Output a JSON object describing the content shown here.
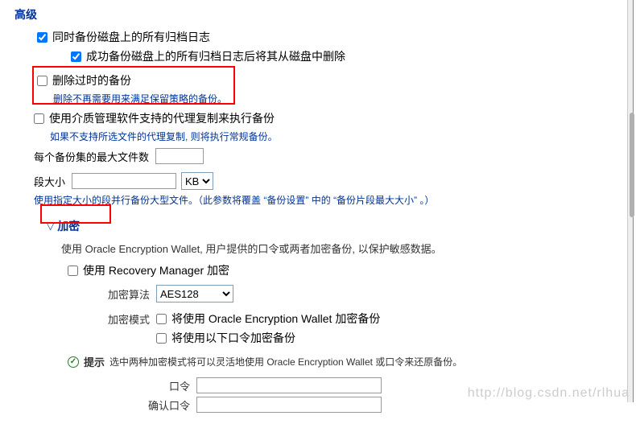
{
  "section": {
    "title": "高级"
  },
  "opts": {
    "archive_all": "同时备份磁盘上的所有归档日志",
    "delete_after": "成功备份磁盘上的所有归档日志后将其从磁盘中删除",
    "delete_expired": "删除过时的备份",
    "delete_expired_desc": "删除不再需要用来满足保留策略的备份。",
    "media_proxy": "使用介质管理软件支持的代理复制来执行备份",
    "media_proxy_desc": "如果不支持所选文件的代理复制, 则将执行常规备份。"
  },
  "maxfiles": {
    "label": "每个备份集的最大文件数",
    "value": ""
  },
  "segment": {
    "label": "段大小",
    "value": "",
    "unit_selected": "KB",
    "desc1": "使用指定大小的段并行备份大型文件。（此参数将覆盖",
    "desc_q1": "“备份设置”",
    "desc_mid": "中的",
    "desc_q2": "“备份片段最大大小”",
    "desc_end": "。）"
  },
  "enc": {
    "header": "加密",
    "desc": "使用 Oracle Encryption Wallet, 用户提供的口令或两者加密备份, 以保护敏感数据。",
    "use_rman": "使用 Recovery Manager 加密",
    "algo_label": "加密算法",
    "algo_selected": "AES128",
    "mode_label": "加密模式",
    "mode_wallet": "将使用 Oracle Encryption Wallet 加密备份",
    "mode_password": "将使用以下口令加密备份",
    "tip_label": "提示",
    "tip_text": "选中两种加密模式将可以灵活地使用 Oracle Encryption Wallet 或口令来还原备份。",
    "pw_label": "口令",
    "pw2_label": "确认口令",
    "pw_value": "",
    "pw2_value": ""
  },
  "watermark": "http://blog.csdn.net/rlhua"
}
